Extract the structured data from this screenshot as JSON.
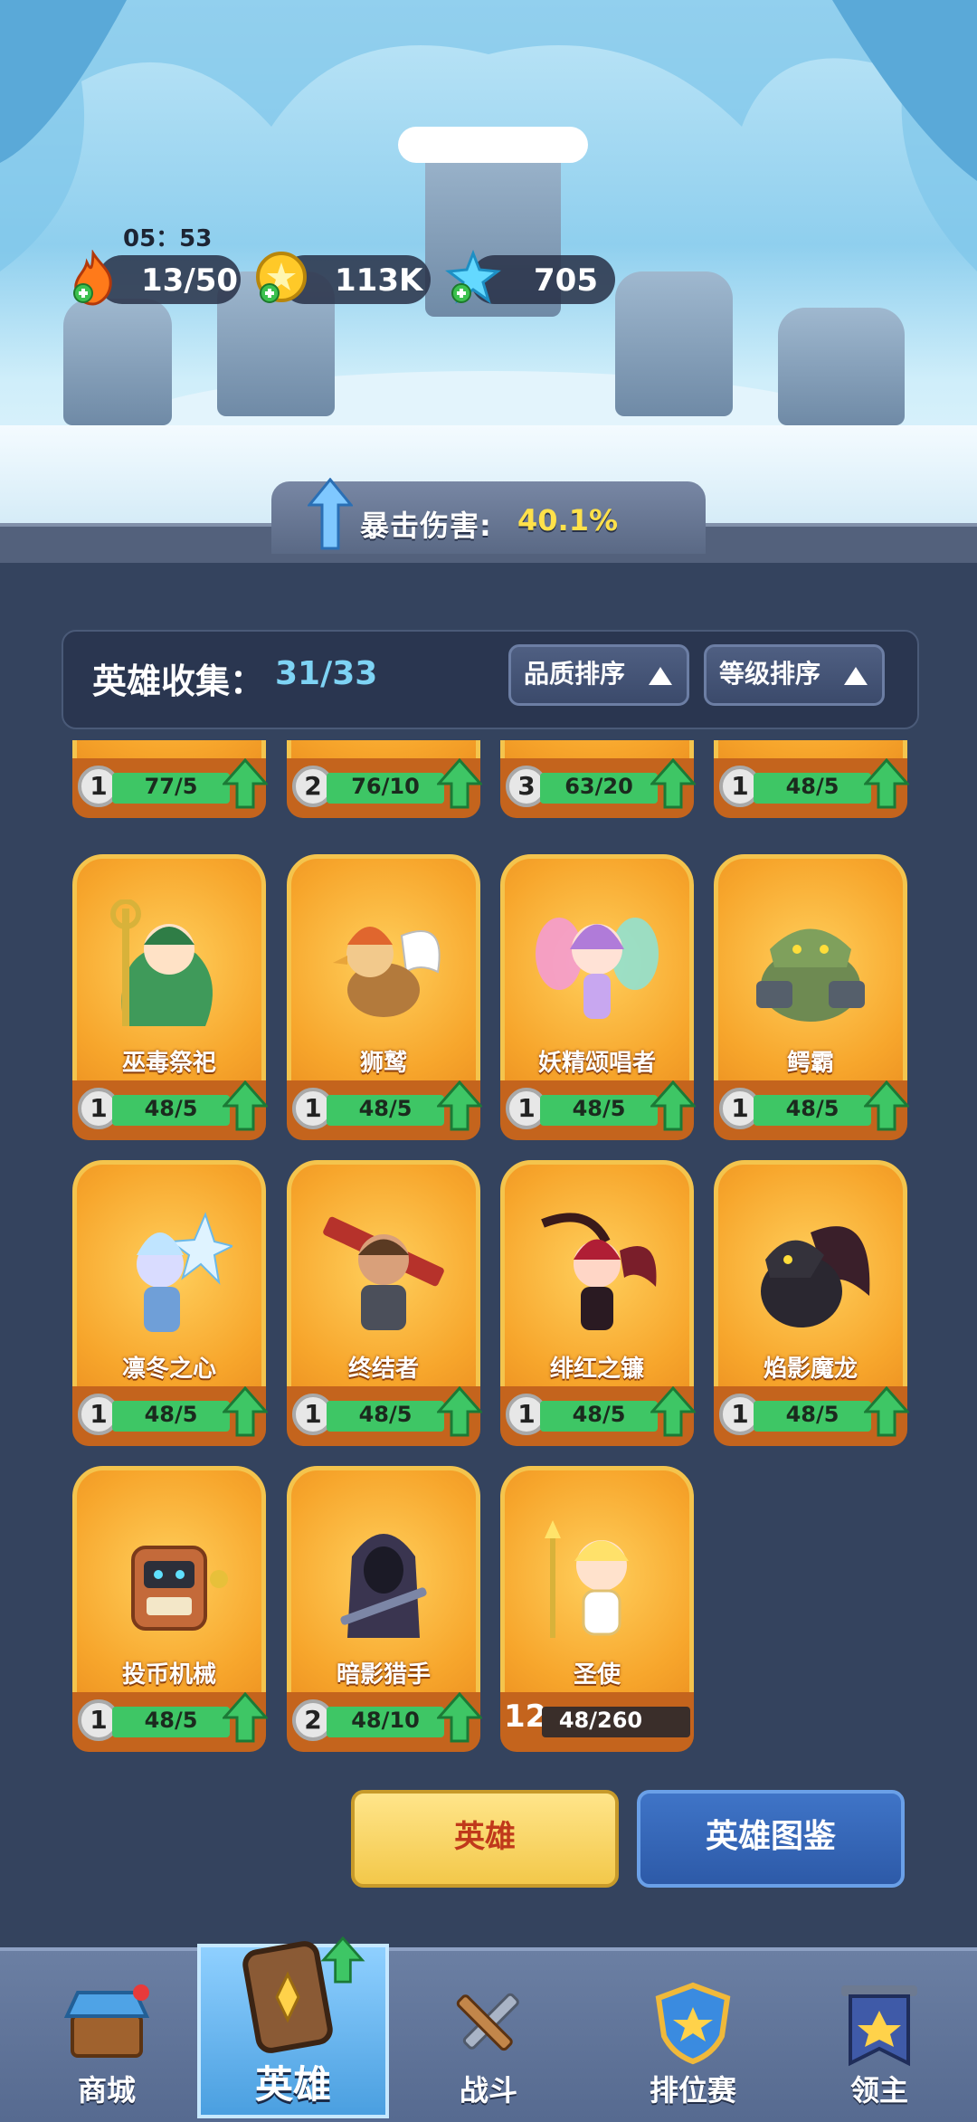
{
  "timer": "05：53",
  "resources": {
    "energy": "13/50",
    "gold": "113K",
    "gems": "705"
  },
  "crit": {
    "label": "暴击伤害:",
    "value": "40.1%"
  },
  "collection": {
    "label": "英雄收集：",
    "value": "31/33",
    "sort_quality": "品质排序",
    "sort_level": "等级排序"
  },
  "top_row": [
    {
      "level": "1",
      "progress": "77/5"
    },
    {
      "level": "2",
      "progress": "76/10"
    },
    {
      "level": "3",
      "progress": "63/20"
    },
    {
      "level": "1",
      "progress": "48/5"
    }
  ],
  "heroes": [
    {
      "name": "巫毒祭祀",
      "level": "1",
      "progress": "48/5"
    },
    {
      "name": "狮鹫",
      "level": "1",
      "progress": "48/5"
    },
    {
      "name": "妖精颂唱者",
      "level": "1",
      "progress": "48/5"
    },
    {
      "name": "鳄霸",
      "level": "1",
      "progress": "48/5"
    },
    {
      "name": "凛冬之心",
      "level": "1",
      "progress": "48/5"
    },
    {
      "name": "终结者",
      "level": "1",
      "progress": "48/5"
    },
    {
      "name": "绯红之镰",
      "level": "1",
      "progress": "48/5"
    },
    {
      "name": "焰影魔龙",
      "level": "1",
      "progress": "48/5"
    },
    {
      "name": "投币机械",
      "level": "1",
      "progress": "48/5"
    },
    {
      "name": "暗影猎手",
      "level": "2",
      "progress": "48/10"
    },
    {
      "name": "圣使",
      "level": "12",
      "progress": "48/260"
    }
  ],
  "buttons": {
    "hero": "英雄",
    "codex": "英雄图鉴"
  },
  "nav": [
    {
      "label": "商城"
    },
    {
      "label": "英雄"
    },
    {
      "label": "战斗"
    },
    {
      "label": "排位赛"
    },
    {
      "label": "领主"
    }
  ]
}
